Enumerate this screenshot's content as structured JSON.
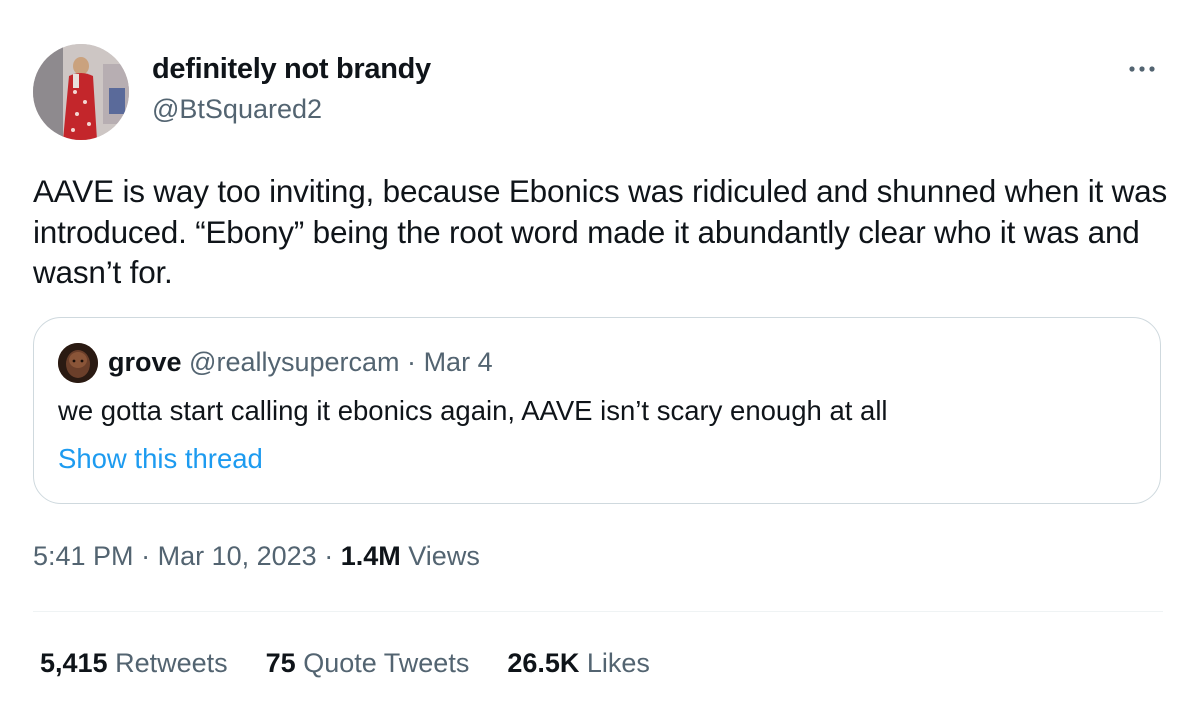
{
  "author": {
    "display_name": "definitely not brandy",
    "handle": "@BtSquared2",
    "avatar_icon": "profile-photo"
  },
  "menu": {
    "more_icon": "ellipsis-icon"
  },
  "tweet": {
    "text": "AAVE is way too inviting, because Ebonics was ridiculed and shunned when it was introduced. “Ebony” being the root word made it abundantly clear who it was and wasn’t for."
  },
  "quoted": {
    "name": "grove",
    "handle": "@reallysupercam",
    "separator": "·",
    "date": "Mar 4",
    "text": "we gotta start calling it ebonics again, AAVE isn’t scary enough at all",
    "show_thread": "Show this thread"
  },
  "meta": {
    "time": "5:41 PM",
    "sep1": "·",
    "date": "Mar 10, 2023",
    "sep2": "·",
    "views_count": "1.4M",
    "views_label": "Views"
  },
  "stats": {
    "retweets_count": "5,415",
    "retweets_label": "Retweets",
    "quotes_count": "75",
    "quotes_label": "Quote Tweets",
    "likes_count": "26.5K",
    "likes_label": "Likes"
  },
  "colors": {
    "text": "#0f1419",
    "secondary": "#536471",
    "link": "#1d9bf0",
    "border": "#cfd9de"
  }
}
